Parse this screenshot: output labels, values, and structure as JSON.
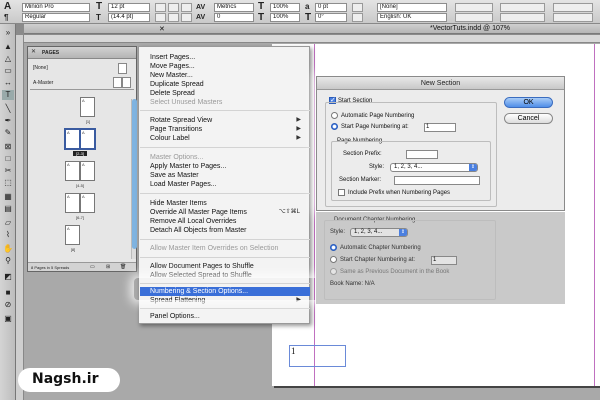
{
  "control_bar": {
    "font_family": "Minion Pro",
    "font_style": "Regular",
    "font_size": "12 pt",
    "leading": "(14.4 pt)",
    "kerning": "Metrics",
    "tracking": "0",
    "scale_v": "100%",
    "scale_h": "100%",
    "baseline": "0 pt",
    "skew": "0°",
    "char_style": "[None]",
    "language": "English: UK",
    "tt_icon": "T",
    "a_icon": "a"
  },
  "document": {
    "title": "*VectorTuts.indd @ 107%",
    "page_number": "1"
  },
  "tools": [
    "pointer",
    "direct-select",
    "page",
    "gap",
    "type",
    "pen",
    "pencil",
    "line",
    "rect-frame",
    "rect",
    "scissors",
    "free-transform",
    "gradient",
    "note",
    "eyedropper",
    "hand",
    "zoom",
    "fill-stroke",
    "apply-color",
    "view-mode"
  ],
  "pages_panel": {
    "title": "PAGES",
    "none_master": "[None]",
    "a_master": "A-Master",
    "page_labels": [
      "[1]",
      "[2-3]",
      "[4-5]",
      "[6-7]",
      "[8]"
    ],
    "thumb_letter": "A",
    "footer": "8 Pages in 5 Spreads"
  },
  "menu": {
    "items": [
      "Insert Pages...",
      "Move Pages...",
      "New Master...",
      "Duplicate Spread",
      "Delete Spread",
      "Select Unused Masters",
      "Rotate Spread View",
      "Page Transitions",
      "Colour Label",
      "Master Options...",
      "Apply Master to Pages...",
      "Save as Master",
      "Load Master Pages...",
      "Hide Master Items",
      "Override All Master Page Items",
      "Remove All Local Overrides",
      "Detach All Objects from Master",
      "Allow Master Item Overrides on Selection",
      "Allow Document Pages to Shuffle",
      "Allow Selected Spread to Shuffle",
      "Numbering & Section Options...",
      "Spread Flattening",
      "Panel Options..."
    ],
    "override_shortcut": "⌥⇧⌘L"
  },
  "dialog": {
    "title": "New Section",
    "start_section": "Start Section",
    "auto_page_numbering": "Automatic Page Numbering",
    "start_page_numbering_at": "Start Page Numbering at:",
    "start_page_value": "1",
    "page_numbering_group": "Page Numbering",
    "section_prefix": "Section Prefix:",
    "style_label": "Style:",
    "style_value": "1, 2, 3, 4...",
    "section_marker": "Section Marker:",
    "include_prefix": "Include Prefix when Numbering Pages",
    "ok": "OK",
    "cancel": "Cancel",
    "chapter_group": "Document Chapter Numbering",
    "chapter_style_label": "Style:",
    "chapter_style_value": "1, 2, 3, 4...",
    "auto_chapter_numbering": "Automatic Chapter Numbering",
    "start_chapter_numbering_at": "Start Chapter Numbering at:",
    "start_chapter_value": "1",
    "same_as_previous": "Same as Previous Document in the Book",
    "book_name": "Book Name: N/A"
  },
  "watermark": "Nagsh.ir"
}
